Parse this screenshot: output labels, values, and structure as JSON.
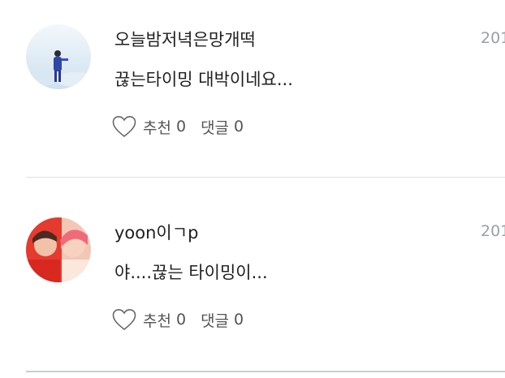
{
  "comments": [
    {
      "author": "오늘밤저녁은망개떡",
      "date": "201",
      "text": "끊는타이밍 대박이네요...",
      "like_label": "추천",
      "like_count": "0",
      "reply_label": "댓글",
      "reply_count": "0"
    },
    {
      "author": "yoon이ㄱp",
      "date": "201",
      "text": "야....끊는 타이밍이...",
      "like_label": "추천",
      "like_count": "0",
      "reply_label": "댓글",
      "reply_count": "0"
    }
  ],
  "colors": {
    "text": "#1f1f1f",
    "muted": "#9aa0a6",
    "divider": "#dfe3e0"
  },
  "icons": {
    "like": "heart-outline-icon"
  }
}
